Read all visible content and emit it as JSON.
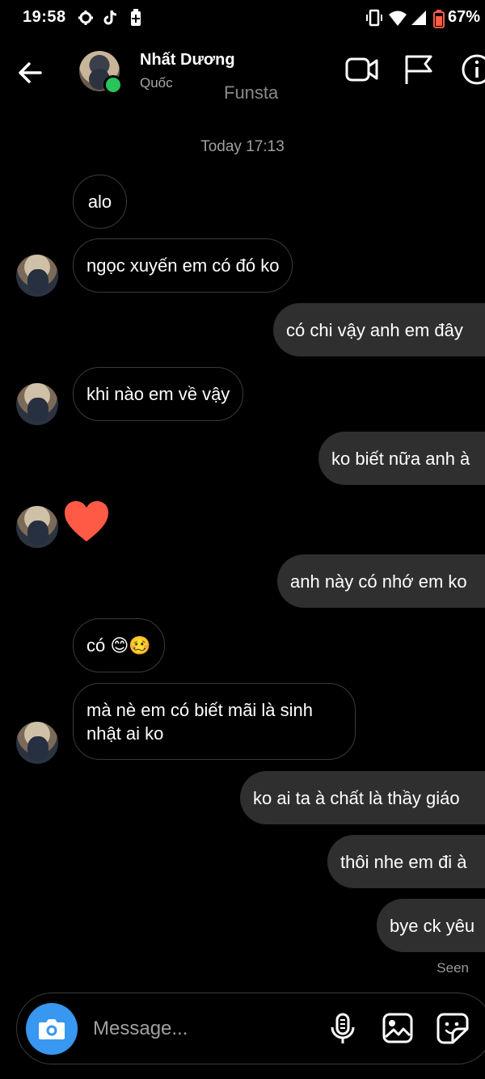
{
  "status_bar": {
    "time": "19:58",
    "battery_percent": "67%"
  },
  "header": {
    "name": "Nhất Dương",
    "subtitle": "Quốc",
    "account_label": "Funsta",
    "online": true
  },
  "thread": {
    "timestamp": "Today 17:13",
    "messages": [
      {
        "from": "them",
        "text": "alo"
      },
      {
        "from": "them",
        "text": "ngọc xuyến em có đó ko"
      },
      {
        "from": "me",
        "text": "có chi vậy anh em đây"
      },
      {
        "from": "them",
        "text": "khi nào em về vậy"
      },
      {
        "from": "me",
        "text": "ko biết nữa anh à"
      },
      {
        "from": "them",
        "reaction": "heart-icon"
      },
      {
        "from": "me",
        "text": "anh này có nhớ em ko"
      },
      {
        "from": "them",
        "text": "có 😊🥴"
      },
      {
        "from": "them",
        "text_line1": "mà nè em có biết mãi là sinh",
        "text_line2": "nhật ai ko"
      },
      {
        "from": "me",
        "text": "ko ai ta à chất là thầy giáo"
      },
      {
        "from": "me",
        "text": "thôi nhe em đi à"
      },
      {
        "from": "me",
        "text": "bye ck yêu"
      }
    ],
    "seen_label": "Seen"
  },
  "composer": {
    "placeholder": "Message..."
  },
  "colors": {
    "background": "#000000",
    "outgoing_bubble": "#2f2f2f",
    "camera_button": "#3897f0",
    "online": "#27c55c",
    "heart": "#ff5a45"
  }
}
